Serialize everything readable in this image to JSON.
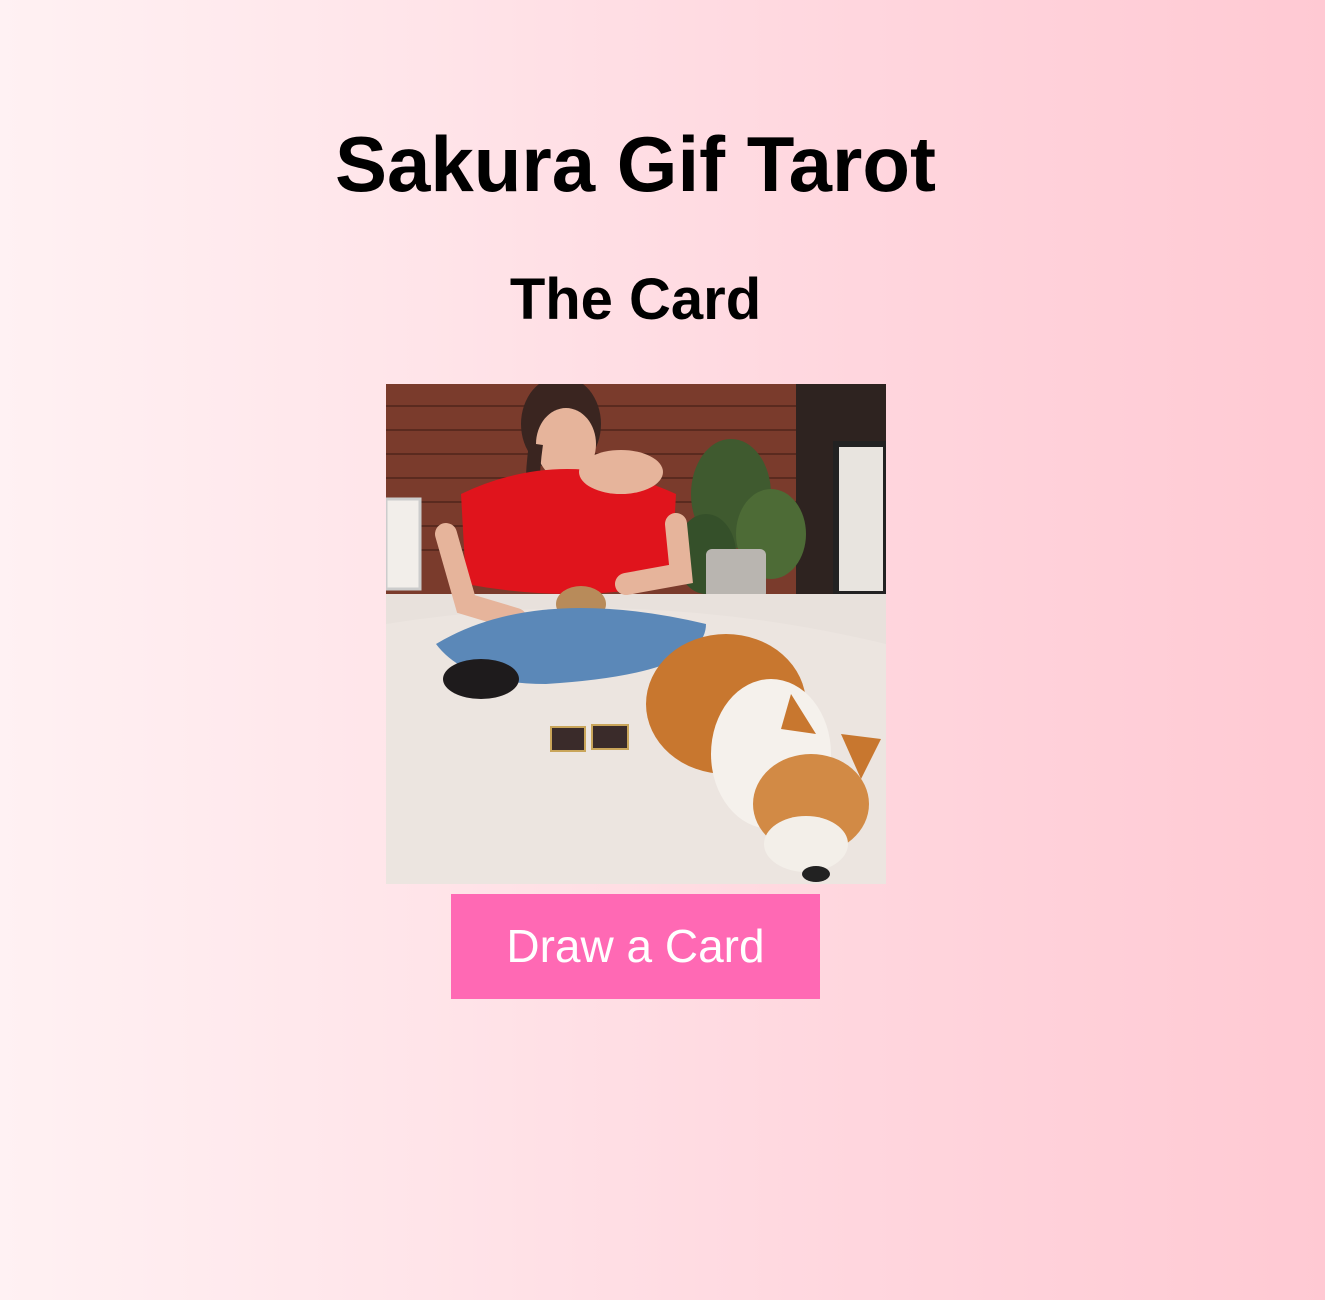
{
  "header": {
    "title": "Sakura Gif Tarot",
    "subtitle": "The Card"
  },
  "card_image": {
    "icon": "tarot-gif-image"
  },
  "actions": {
    "draw_label": "Draw a Card"
  },
  "colors": {
    "button_background": "#ff69b4",
    "button_text": "#ffffff",
    "heading_text": "#000000",
    "background_left": "#fff1f3",
    "background_right": "#ffc9d3"
  }
}
